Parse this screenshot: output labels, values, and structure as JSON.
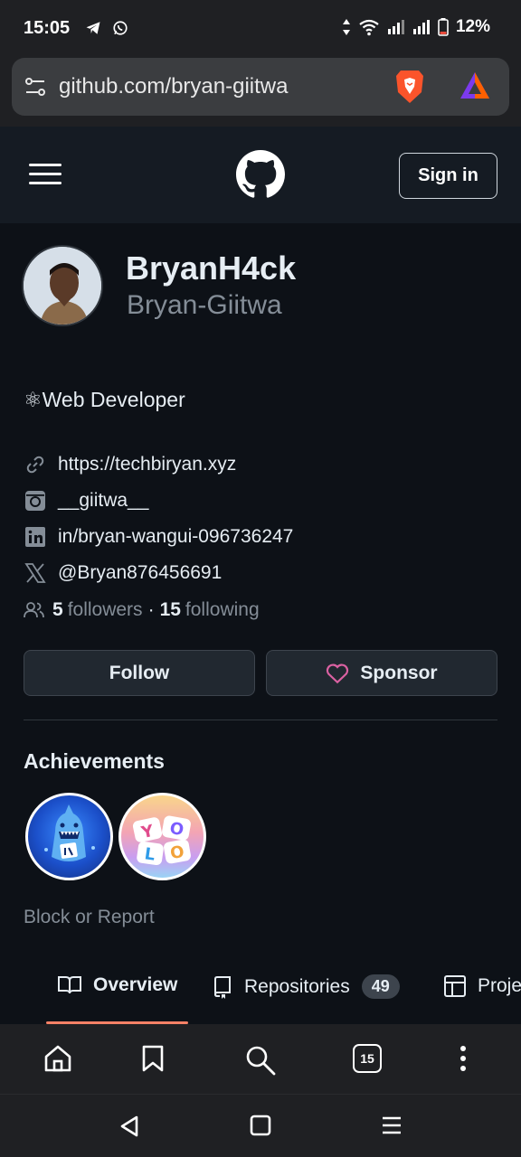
{
  "status_bar": {
    "time": "15:05",
    "battery": "12%"
  },
  "browser": {
    "url": "github.com/bryan-giitwa"
  },
  "header": {
    "sign_in_label": "Sign in"
  },
  "profile": {
    "display_name": "BryanH4ck",
    "username": "Bryan-Giitwa",
    "bio": "⚛Web Developer",
    "links": [
      {
        "icon": "link-icon",
        "text": "https://techbiryan.xyz"
      },
      {
        "icon": "instagram-icon",
        "text": "__giitwa__"
      },
      {
        "icon": "linkedin-icon",
        "text": "in/bryan-wangui-096736247"
      },
      {
        "icon": "x-icon",
        "text": "@Bryan876456691"
      }
    ],
    "followers_count": "5",
    "followers_label": "followers",
    "separator": "·",
    "following_count": "15",
    "following_label": "following",
    "follow_label": "Follow",
    "sponsor_label": "Sponsor",
    "achievements_title": "Achievements",
    "block_report_label": "Block or Report"
  },
  "tabs": [
    {
      "label": "Overview"
    },
    {
      "label": "Repositories",
      "count": "49"
    },
    {
      "label": "Proje"
    }
  ],
  "toolbar": {
    "tabs_count": "15"
  },
  "colors": {
    "accent_underline": "#f78166",
    "heart": "#db61a2",
    "page_bg": "#0d1117"
  }
}
